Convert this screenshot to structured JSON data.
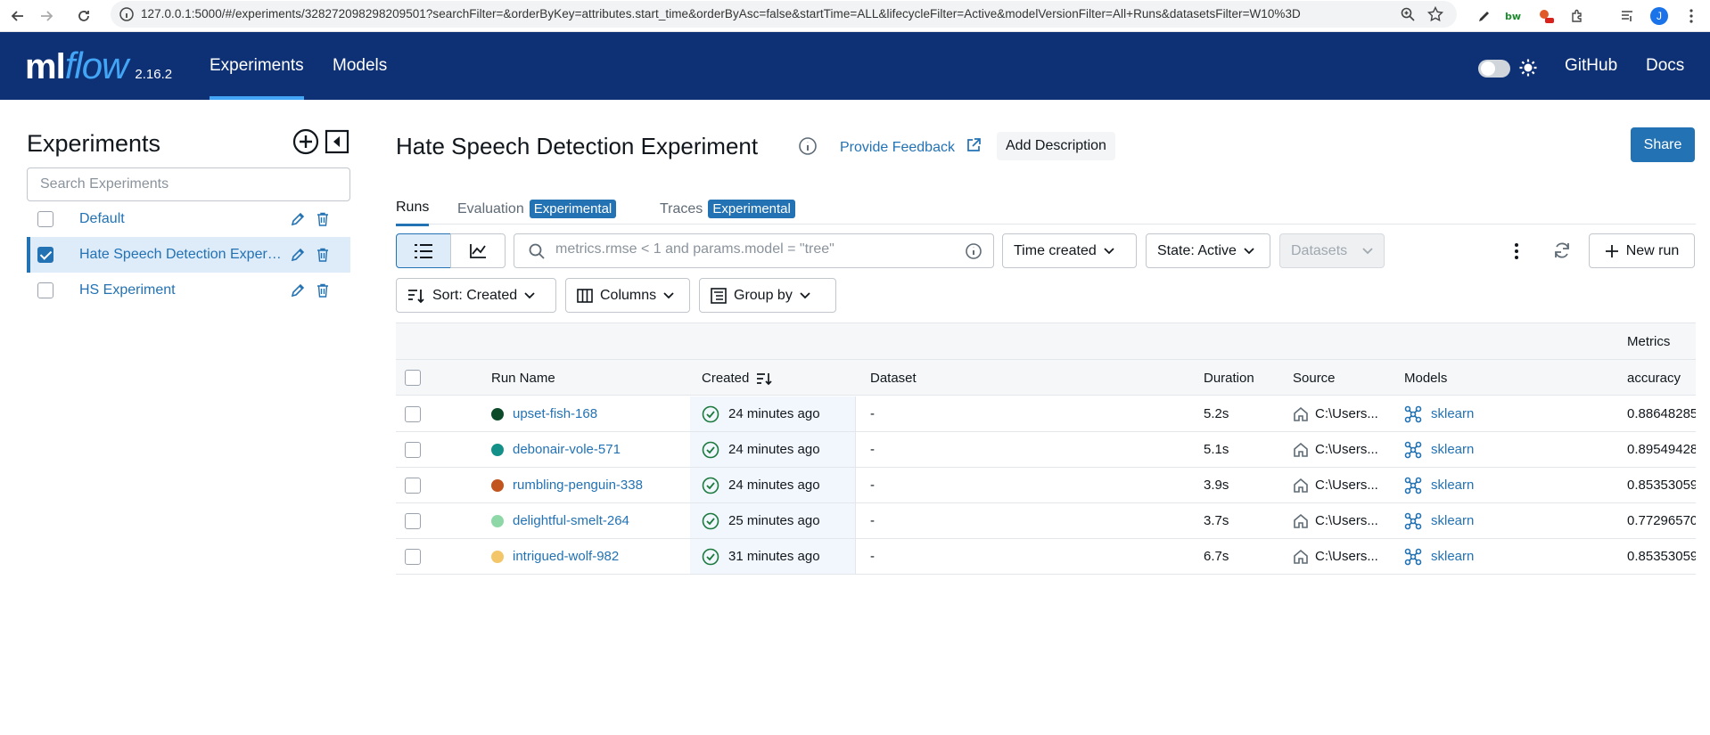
{
  "browser": {
    "url": "127.0.0.1:5000/#/experiments/328272098298209501?searchFilter=&orderByKey=attributes.start_time&orderByAsc=false&startTime=ALL&lifecycleFilter=Active&modelVersionFilter=All+Runs&datasetsFilter=W10%3D",
    "profile_initial": "J"
  },
  "header": {
    "logo_ml": "ml",
    "logo_flow": "flow",
    "version": "2.16.2",
    "nav": [
      {
        "label": "Experiments",
        "active": true
      },
      {
        "label": "Models",
        "active": false
      }
    ],
    "github": "GitHub",
    "docs": "Docs"
  },
  "sidebar": {
    "title": "Experiments",
    "search_placeholder": "Search Experiments",
    "experiments": [
      {
        "name": "Default",
        "checked": false
      },
      {
        "name": "Hate Speech Detection Experiment",
        "checked": true
      },
      {
        "name": "HS Experiment",
        "checked": false
      }
    ]
  },
  "main": {
    "title": "Hate Speech Detection Experiment",
    "provide_feedback": "Provide Feedback",
    "add_description": "Add Description",
    "share": "Share",
    "tabs": [
      {
        "label": "Runs",
        "badge": ""
      },
      {
        "label": "Evaluation",
        "badge": "Experimental"
      },
      {
        "label": "Traces",
        "badge": "Experimental"
      }
    ],
    "search_placeholder": "metrics.rmse < 1 and params.model = \"tree\"",
    "filters": {
      "time_created": "Time created",
      "state": "State: Active",
      "datasets": "Datasets",
      "new_run": "New run",
      "sort": "Sort: Created",
      "columns": "Columns",
      "group_by": "Group by"
    },
    "table": {
      "group_metrics": "Metrics",
      "columns": {
        "run_name": "Run Name",
        "created": "Created",
        "dataset": "Dataset",
        "duration": "Duration",
        "source": "Source",
        "models": "Models",
        "accuracy": "accuracy"
      },
      "rows": [
        {
          "name": "upset-fish-168",
          "color": "#0d4a2a",
          "created": "24 minutes ago",
          "dataset": "-",
          "duration": "5.2s",
          "source": "C:\\Users...",
          "model": "sklearn",
          "accuracy": "0.88648285"
        },
        {
          "name": "debonair-vole-571",
          "color": "#139088",
          "created": "24 minutes ago",
          "dataset": "-",
          "duration": "5.1s",
          "source": "C:\\Users...",
          "model": "sklearn",
          "accuracy": "0.89549428"
        },
        {
          "name": "rumbling-penguin-338",
          "color": "#c2541d",
          "created": "24 minutes ago",
          "dataset": "-",
          "duration": "3.9s",
          "source": "C:\\Users...",
          "model": "sklearn",
          "accuracy": "0.85353059"
        },
        {
          "name": "delightful-smelt-264",
          "color": "#8ed8a8",
          "created": "25 minutes ago",
          "dataset": "-",
          "duration": "3.7s",
          "source": "C:\\Users...",
          "model": "sklearn",
          "accuracy": "0.77296570"
        },
        {
          "name": "intrigued-wolf-982",
          "color": "#f3c769",
          "created": "31 minutes ago",
          "dataset": "-",
          "duration": "6.7s",
          "source": "C:\\Users...",
          "model": "sklearn",
          "accuracy": "0.85353059"
        }
      ]
    }
  }
}
